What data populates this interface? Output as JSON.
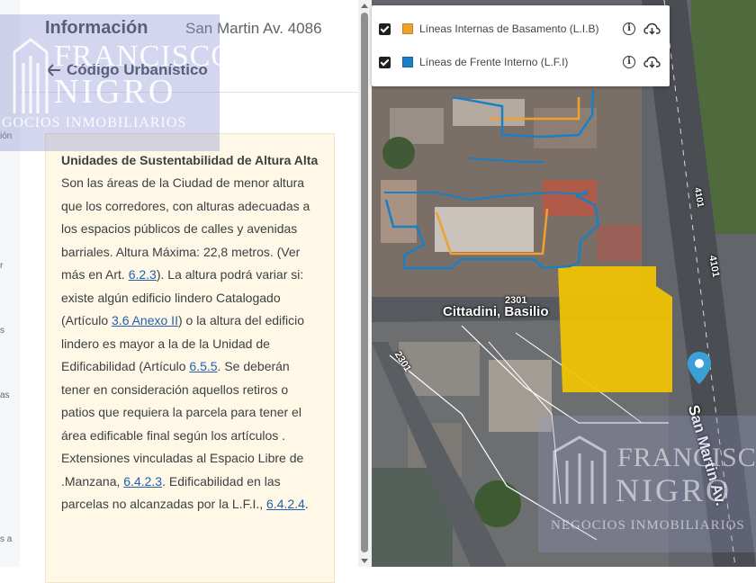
{
  "rail": {
    "fragments": [
      "ión",
      "r",
      "s",
      "as",
      "s a"
    ]
  },
  "panel": {
    "title": "Información",
    "address": "San Martin Av. 4086",
    "back_label": "Código Urbanístico",
    "info_title": "Unidades de Sustentabilidad de Altura Alta",
    "body_1": "Son las áreas de la Ciudad de menor altura que los corredores, con alturas adecuadas a los espacios públicos de calles y avenidas barriales. Altura Máxima: 22,8 metros. (Ver más en Art. ",
    "link_1": "6.2.3",
    "body_2": "). La altura podrá variar si: existe algún edificio lindero Catalogado (Artículo ",
    "link_2": "3.6 Anexo II",
    "body_3": ") o la altura del edificio lindero es mayor a la de la Unidad de Edificabilidad (Artículo ",
    "link_3": "6.5.5",
    "body_4": ". Se deberán tener en consideración aquellos retiros o patios que requiera la parcela para tener el área edificable final según los artículos . Extensiones vinculadas al Espacio Libre de .Manzana, ",
    "link_4": "6.4.2.3",
    "body_5": ". Edificabilidad en las parcelas no alcanzadas por la L.F.I., ",
    "link_5": "6.4.2.4",
    "body_6": "."
  },
  "watermark": {
    "name_line1": "FRANCISCO",
    "name_line2": "NIGRO",
    "tagline": "NEGOCIOS INMOBILIARIOS",
    "tagline_clipped": "GOCIOS INMOBILIARIOS"
  },
  "layers": [
    {
      "label": "Líneas Internas de Basamento (L.I.B)",
      "color": "#f0a030",
      "checked": true
    },
    {
      "label": "Líneas de Frente Interno (L.F.I)",
      "color": "#1a7fc4",
      "checked": true
    }
  ],
  "map": {
    "street_label": "Cittadini, Basilio",
    "block_number": "2301",
    "block_number_2": "2301",
    "avenue_label": "San Martin Av.",
    "avenue_number": "4101",
    "avenue_number_2": "4101",
    "highlight_color": "#f2c400",
    "pin_color": "#3aa0d8"
  }
}
